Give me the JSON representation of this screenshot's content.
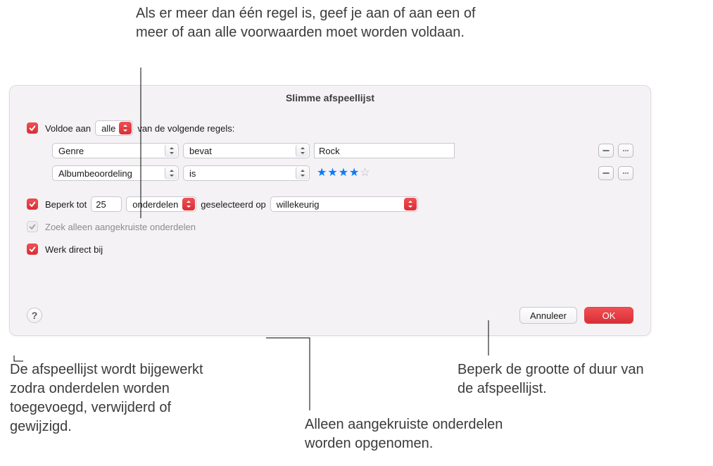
{
  "callouts": {
    "top": "Als er meer dan één regel is, geef je aan of aan een of meer of aan alle voorwaarden moet worden voldaan.",
    "bottom_left": "De afspeellijst wordt bijgewerkt zodra onderdelen worden toegevoegd, verwijderd of gewijzigd.",
    "bottom_mid": "Alleen aangekruiste onderdelen worden opgenomen.",
    "bottom_right": "Beperk de grootte of duur van de afspeellijst."
  },
  "dialog": {
    "title": "Slimme afspeellijst",
    "match": {
      "prefix": "Voldoe aan",
      "mode": "alle",
      "suffix": "van de volgende regels:"
    },
    "rules": [
      {
        "field": "Genre",
        "op": "bevat",
        "value": "Rock",
        "type": "text"
      },
      {
        "field": "Albumbeoordeling",
        "op": "is",
        "type": "stars",
        "stars": 4,
        "stars_max": 5
      }
    ],
    "limit": {
      "prefix": "Beperk tot",
      "count": "25",
      "unit": "onderdelen",
      "selected_by_label": "geselecteerd op",
      "selected_by": "willekeurig"
    },
    "only_checked": "Zoek alleen aangekruiste onderdelen",
    "live_updating": "Werk direct bij",
    "buttons": {
      "cancel": "Annuleer",
      "ok": "OK"
    },
    "help_glyph": "?"
  }
}
